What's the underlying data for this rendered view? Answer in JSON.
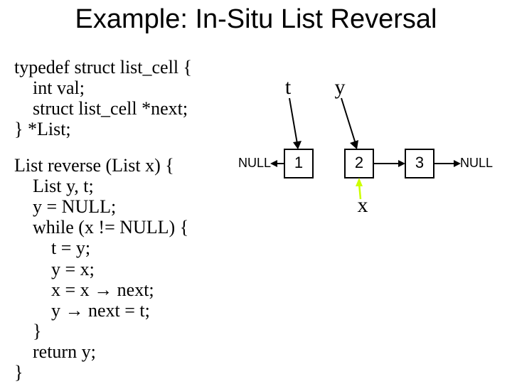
{
  "title": "Example: In-Situ List Reversal",
  "typedef": {
    "l1": "typedef struct list_cell {",
    "l2": "    int val;",
    "l3": "    struct list_cell *next;",
    "l4": "} *List;"
  },
  "func": {
    "l1": "List reverse (List x) {",
    "l2": "    List y, t;",
    "l3": "    y = NULL;",
    "l4": "    while (x != NULL) {",
    "l5": "        t = y;",
    "l6": "        y = x;",
    "l7_a": "        x = x ",
    "l7_b": " next;",
    "l8_a": "        y ",
    "l8_b": " next = t;",
    "l9": "    }",
    "l10": "    return y;",
    "l11": "}"
  },
  "diagram": {
    "null_left": "NULL",
    "null_right": "NULL",
    "nodes": [
      "1",
      "2",
      "3"
    ],
    "ptr_t": "t",
    "ptr_y": "y",
    "ptr_x": "x"
  },
  "arrow_glyph": "→"
}
